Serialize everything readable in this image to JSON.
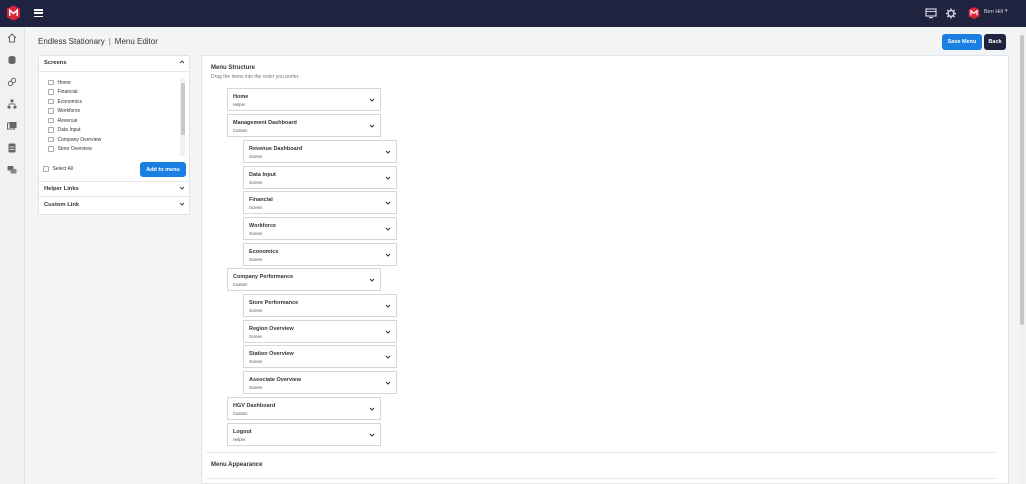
{
  "topbar": {
    "user_name": "Ben Hill",
    "colors": {
      "bg": "#1f2340",
      "brand": "#d8253a"
    },
    "icons": [
      "brand-logo",
      "hamburger-menu-icon",
      "monitor-icon",
      "gear-icon",
      "user-brand-icon",
      "chevron-down-icon"
    ]
  },
  "rail": {
    "icons": [
      "home-icon",
      "database-icon",
      "link-icon",
      "sitemap-icon",
      "images-icon",
      "server-icon",
      "chat-icon"
    ]
  },
  "header": {
    "company": "Endless Stationary",
    "separator": "|",
    "page": "Menu Editor",
    "save_label": "Save Menu",
    "back_label": "Back"
  },
  "left_panel": {
    "screens_title": "Screens",
    "screens": [
      "Home",
      "Financial",
      "Economics",
      "Workforce",
      "Revenue",
      "Data Input",
      "Company Overview",
      "Store Overview"
    ],
    "select_all_label": "Select All",
    "add_label": "Add to menu",
    "helper_links_title": "Helper Links",
    "custom_link_title": "Custom Link"
  },
  "menu_structure": {
    "title": "Menu Structure",
    "hint": "Drag the items into the order you prefer.",
    "items": [
      {
        "name": "Home",
        "kind": "Helper"
      },
      {
        "name": "Management Dashboard",
        "kind": "Custom"
      },
      {
        "name": "Revenue Dashboard",
        "kind": "Screen"
      },
      {
        "name": "Data Input",
        "kind": "Screen"
      },
      {
        "name": "Financial",
        "kind": "Screen"
      },
      {
        "name": "Workforce",
        "kind": "Screen"
      },
      {
        "name": "Economics",
        "kind": "Screen"
      },
      {
        "name": "Company Performance",
        "kind": "Custom"
      },
      {
        "name": "Store Performance",
        "kind": "Screen"
      },
      {
        "name": "Region Overview",
        "kind": "Screen"
      },
      {
        "name": "Station Overview",
        "kind": "Screen"
      },
      {
        "name": "Associate Overview",
        "kind": "Screen"
      },
      {
        "name": "HGV Dashboard",
        "kind": "Custom"
      },
      {
        "name": "Logout",
        "kind": "Helper"
      }
    ]
  },
  "menu_appearance_title": "Menu Appearance"
}
